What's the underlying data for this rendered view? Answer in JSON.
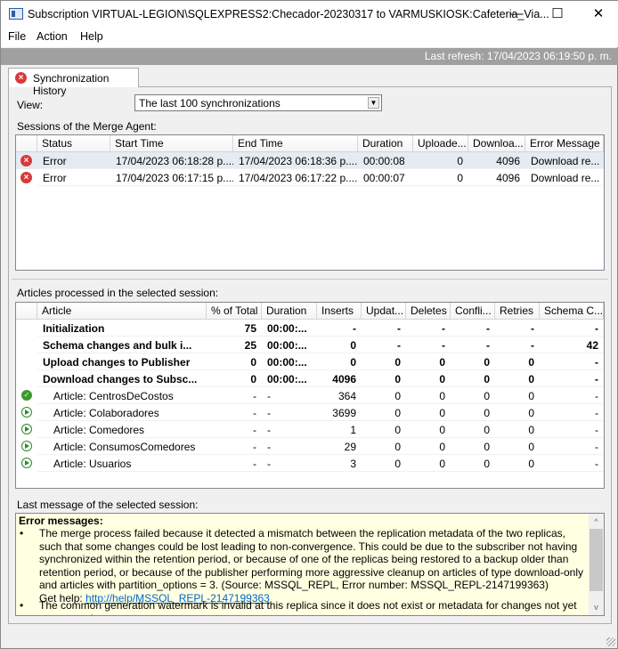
{
  "window": {
    "title": "Subscription VIRTUAL-LEGION\\SQLEXPRESS2:Checador-20230317 to VARMUSKIOSK:Cafeteria_Via...",
    "minimize": "—",
    "maximize": "☐",
    "close": "✕"
  },
  "menu": [
    "File",
    "Action",
    "Help"
  ],
  "refresh": "Last refresh: 17/04/2023 06:19:50 p. m.",
  "tab": {
    "label": "Synchronization History",
    "icon": "error-icon"
  },
  "view": {
    "label": "View:",
    "value": "The last 100 synchronizations"
  },
  "sessions": {
    "label": "Sessions of the Merge Agent:",
    "columns": [
      "",
      "Status",
      "Start Time",
      "End Time",
      "Duration",
      "Uploade...",
      "Downloa...",
      "Error Message"
    ],
    "rows": [
      [
        "",
        "Error",
        "17/04/2023 06:18:28 p....",
        "17/04/2023 06:18:36 p....",
        "00:00:08",
        "0",
        "4096",
        "Download re..."
      ],
      [
        "",
        "Error",
        "17/04/2023 06:17:15 p....",
        "17/04/2023 06:17:22 p....",
        "00:00:07",
        "0",
        "4096",
        "Download re..."
      ]
    ]
  },
  "articles": {
    "label": "Articles processed in the selected session:",
    "columns": [
      "",
      "Article",
      "% of Total",
      "Duration",
      "Inserts",
      "Updat...",
      "Deletes",
      "Confli...",
      "Retries",
      "Schema C..."
    ],
    "rows": [
      {
        "icon": "",
        "bold": true,
        "cells": [
          "Initialization",
          "75",
          "00:00:...",
          "-",
          "-",
          "-",
          "-",
          "-",
          "-"
        ]
      },
      {
        "icon": "",
        "bold": true,
        "cells": [
          "Schema changes and bulk i...",
          "25",
          "00:00:...",
          "0",
          "-",
          "-",
          "-",
          "-",
          "42"
        ]
      },
      {
        "icon": "",
        "bold": true,
        "cells": [
          "Upload changes to Publisher",
          "0",
          "00:00:...",
          "0",
          "0",
          "0",
          "0",
          "0",
          "-"
        ]
      },
      {
        "icon": "",
        "bold": true,
        "cells": [
          "Download changes to Subsc...",
          "0",
          "00:00:...",
          "4096",
          "0",
          "0",
          "0",
          "0",
          "-"
        ]
      },
      {
        "icon": "check",
        "bold": false,
        "cells": [
          "Article: CentrosDeCostos",
          "-",
          "-",
          "364",
          "0",
          "0",
          "0",
          "0",
          "-"
        ]
      },
      {
        "icon": "play",
        "bold": false,
        "cells": [
          "Article: Colaboradores",
          "-",
          "-",
          "3699",
          "0",
          "0",
          "0",
          "0",
          "-"
        ]
      },
      {
        "icon": "play",
        "bold": false,
        "cells": [
          "Article: Comedores",
          "-",
          "-",
          "1",
          "0",
          "0",
          "0",
          "0",
          "-"
        ]
      },
      {
        "icon": "play",
        "bold": false,
        "cells": [
          "Article: ConsumosComedores",
          "-",
          "-",
          "29",
          "0",
          "0",
          "0",
          "0",
          "-"
        ]
      },
      {
        "icon": "play",
        "bold": false,
        "cells": [
          "Article: Usuarios",
          "-",
          "-",
          "3",
          "0",
          "0",
          "0",
          "0",
          "-"
        ]
      }
    ]
  },
  "message": {
    "label": "Last message of the selected session:",
    "heading": "Error messages:",
    "item1": "The merge process failed because it detected a mismatch between the replication metadata of the two replicas, such that some changes could be lost leading to non-convergence. This could be due to the subscriber not having synchronized within the retention period, or because of one of the replicas being restored to a backup older than retention period, or because of the publisher performing more aggressive cleanup on articles of type download-only and articles with partition_options = 3. (Source: MSSQL_REPL, Error number: MSSQL_REPL-2147199363)",
    "help_label": "Get help: ",
    "help_link": "http://help/MSSQL_REPL-2147199363",
    "item2": "The common generation watermark is invalid at this replica since it does not exist or metadata for changes not yet propagated may"
  }
}
